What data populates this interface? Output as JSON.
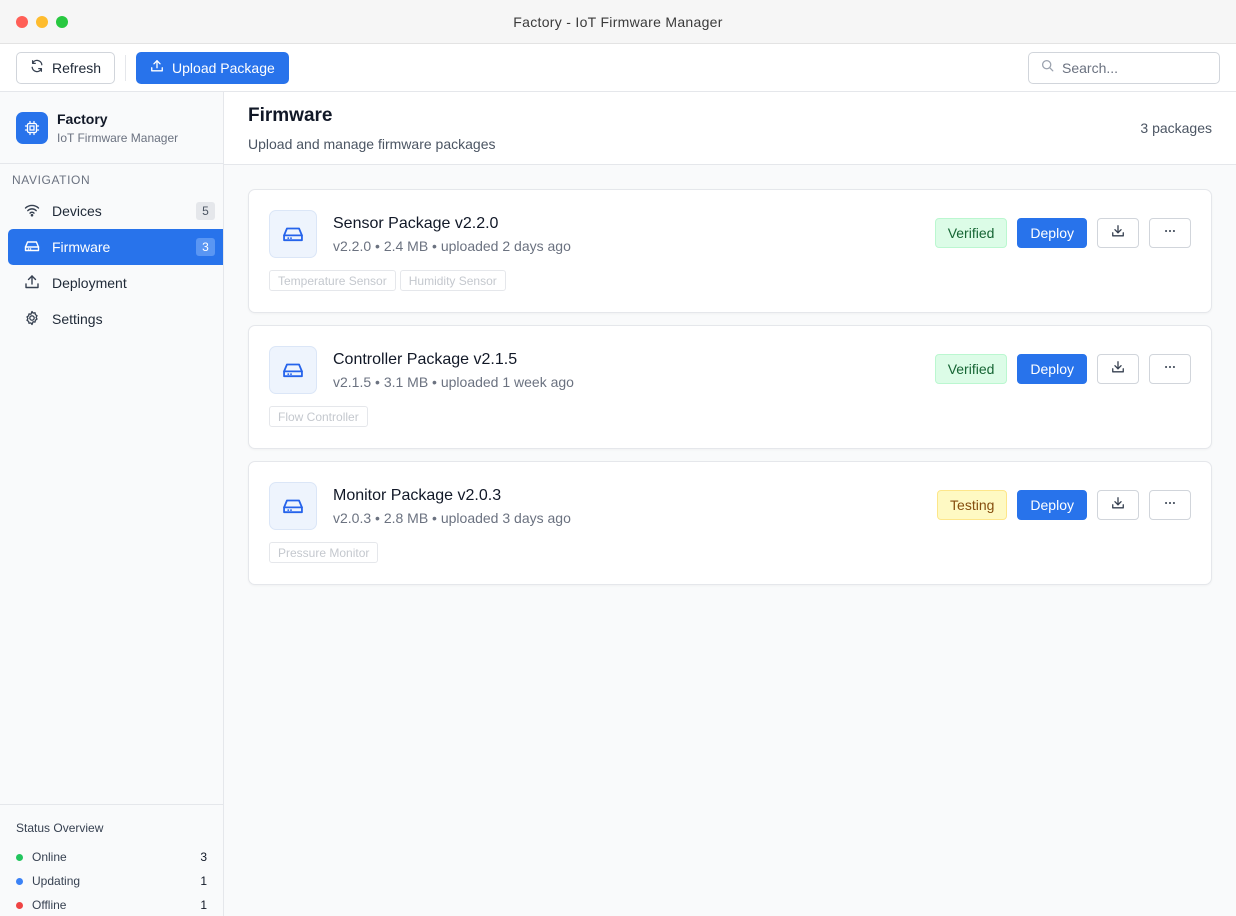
{
  "window": {
    "title": "Factory - IoT Firmware Manager"
  },
  "toolbar": {
    "refresh_label": "Refresh",
    "upload_label": "Upload Package",
    "search_placeholder": "Search..."
  },
  "sidebar": {
    "brand_name": "Factory",
    "brand_sub": "IoT Firmware Manager",
    "nav_heading": "NAVIGATION",
    "items": [
      {
        "label": "Devices",
        "badge": "5",
        "icon": "wifi-icon",
        "active": false
      },
      {
        "label": "Firmware",
        "badge": "3",
        "icon": "hard-drive-icon",
        "active": true
      },
      {
        "label": "Deployment",
        "badge": null,
        "icon": "upload-icon",
        "active": false
      },
      {
        "label": "Settings",
        "badge": null,
        "icon": "gear-icon",
        "active": false
      }
    ],
    "status": {
      "title": "Status Overview",
      "rows": [
        {
          "label": "Online",
          "count": "3",
          "color": "#22c55e"
        },
        {
          "label": "Updating",
          "count": "1",
          "color": "#3b82f6"
        },
        {
          "label": "Offline",
          "count": "1",
          "color": "#ef4444"
        }
      ]
    }
  },
  "page": {
    "title": "Firmware",
    "subtitle": "Upload and manage firmware packages",
    "count": "3 packages"
  },
  "packages": [
    {
      "name": "Sensor Package v2.2.0",
      "meta": "v2.2.0 • 2.4 MB • uploaded 2 days ago",
      "tags": [
        "Temperature Sensor",
        "Humidity Sensor"
      ],
      "status": "Verified",
      "deploy_label": "Deploy"
    },
    {
      "name": "Controller Package v2.1.5",
      "meta": "v2.1.5 • 3.1 MB • uploaded 1 week ago",
      "tags": [
        "Flow Controller"
      ],
      "status": "Verified",
      "deploy_label": "Deploy"
    },
    {
      "name": "Monitor Package v2.0.3",
      "meta": "v2.0.3 • 2.8 MB • uploaded 3 days ago",
      "tags": [
        "Pressure Monitor"
      ],
      "status": "Testing",
      "deploy_label": "Deploy"
    }
  ],
  "colors": {
    "accent": "#2873eb",
    "verified_bg": "#dcfce7",
    "testing_bg": "#fef9c3"
  }
}
